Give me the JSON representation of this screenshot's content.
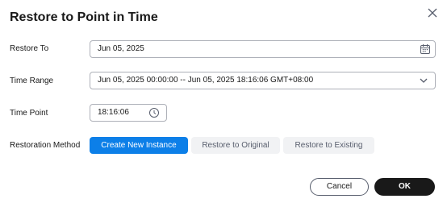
{
  "dialog": {
    "title": "Restore to Point in Time"
  },
  "form": {
    "restore_to": {
      "label": "Restore To",
      "value": "Jun 05, 2025"
    },
    "time_range": {
      "label": "Time Range",
      "value": "Jun 05, 2025 00:00:00 -- Jun 05, 2025 18:16:06 GMT+08:00"
    },
    "time_point": {
      "label": "Time Point",
      "value": "18:16:06"
    },
    "restoration_method": {
      "label": "Restoration Method",
      "options": [
        "Create New Instance",
        "Restore to Original",
        "Restore to Existing"
      ],
      "selected": "Create New Instance"
    }
  },
  "footer": {
    "cancel_label": "Cancel",
    "ok_label": "OK"
  },
  "colors": {
    "accent": "#0c7fe8",
    "primary_button": "#191919",
    "inactive_segment": "#f1f2f4"
  },
  "icons": {
    "close": "close-icon",
    "calendar": "calendar-icon",
    "dropdown": "chevron-down-icon",
    "clock": "clock-icon"
  }
}
